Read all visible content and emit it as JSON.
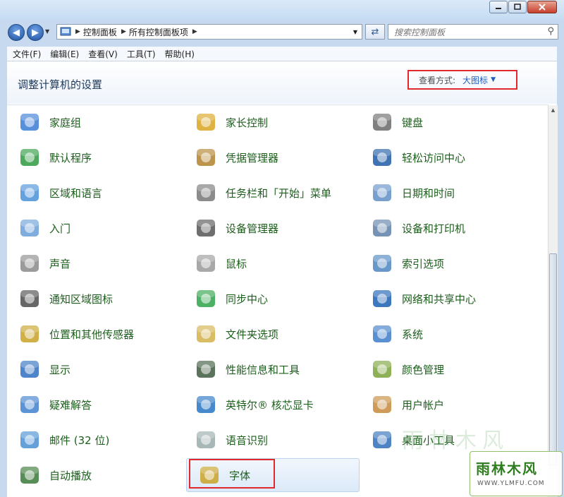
{
  "address": {
    "crumbs": [
      "控制面板",
      "所有控制面板项"
    ]
  },
  "search": {
    "placeholder": "搜索控制面板"
  },
  "menu": [
    "文件(F)",
    "编辑(E)",
    "查看(V)",
    "工具(T)",
    "帮助(H)"
  ],
  "header": {
    "title": "调整计算机的设置",
    "view_by_label": "查看方式:",
    "view_by_value": "大图标"
  },
  "items": [
    {
      "label": "家庭组",
      "icon": "homegroup-icon"
    },
    {
      "label": "家长控制",
      "icon": "parental-controls-icon"
    },
    {
      "label": "键盘",
      "icon": "keyboard-icon"
    },
    {
      "label": "默认程序",
      "icon": "default-programs-icon"
    },
    {
      "label": "凭据管理器",
      "icon": "credential-manager-icon"
    },
    {
      "label": "轻松访问中心",
      "icon": "ease-of-access-icon"
    },
    {
      "label": "区域和语言",
      "icon": "region-language-icon"
    },
    {
      "label": "任务栏和「开始」菜单",
      "icon": "taskbar-start-icon"
    },
    {
      "label": "日期和时间",
      "icon": "date-time-icon"
    },
    {
      "label": "入门",
      "icon": "getting-started-icon"
    },
    {
      "label": "设备管理器",
      "icon": "device-manager-icon"
    },
    {
      "label": "设备和打印机",
      "icon": "devices-printers-icon"
    },
    {
      "label": "声音",
      "icon": "sound-icon"
    },
    {
      "label": "鼠标",
      "icon": "mouse-icon"
    },
    {
      "label": "索引选项",
      "icon": "indexing-options-icon"
    },
    {
      "label": "通知区域图标",
      "icon": "notification-area-icon"
    },
    {
      "label": "同步中心",
      "icon": "sync-center-icon"
    },
    {
      "label": "网络和共享中心",
      "icon": "network-sharing-icon"
    },
    {
      "label": "位置和其他传感器",
      "icon": "location-sensors-icon"
    },
    {
      "label": "文件夹选项",
      "icon": "folder-options-icon"
    },
    {
      "label": "系统",
      "icon": "system-icon"
    },
    {
      "label": "显示",
      "icon": "display-icon"
    },
    {
      "label": "性能信息和工具",
      "icon": "performance-icon"
    },
    {
      "label": "颜色管理",
      "icon": "color-management-icon"
    },
    {
      "label": "疑难解答",
      "icon": "troubleshooting-icon"
    },
    {
      "label": "英特尔® 核芯显卡",
      "icon": "intel-graphics-icon"
    },
    {
      "label": "用户帐户",
      "icon": "user-accounts-icon"
    },
    {
      "label": "邮件 (32 位)",
      "icon": "mail-icon"
    },
    {
      "label": "语音识别",
      "icon": "speech-recognition-icon"
    },
    {
      "label": "桌面小工具",
      "icon": "desktop-gadgets-icon"
    },
    {
      "label": "自动播放",
      "icon": "autoplay-icon"
    },
    {
      "label": "字体",
      "icon": "fonts-icon"
    }
  ],
  "watermark": {
    "text": "雨林木风",
    "url": "WWW.YLMFU.COM"
  }
}
